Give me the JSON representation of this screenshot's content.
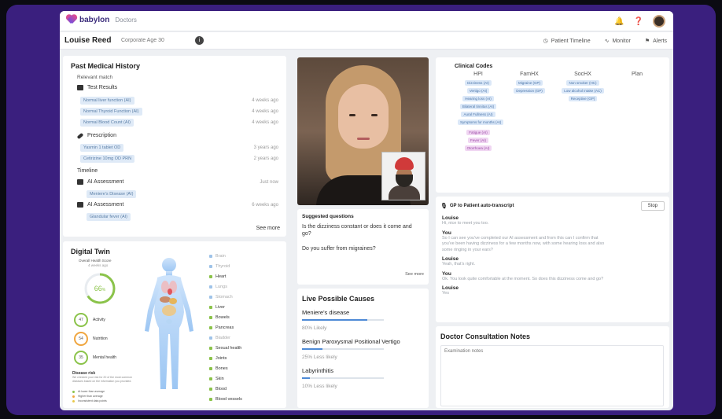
{
  "app": {
    "brand": "babylon",
    "section": "Doctors"
  },
  "patient": {
    "name": "Louise Reed",
    "meta": "Corporate   Age 30",
    "info_glyph": "i"
  },
  "nav": {
    "timeline": "Patient Timeline",
    "monitor": "Monitor",
    "alerts": "Alerts"
  },
  "history": {
    "title": "Past Medical History",
    "subtitle": "Relevant match",
    "test_results_label": "Test Results",
    "test_results": [
      {
        "name": "Normal liver function (AI)",
        "when": "4 weeks ago"
      },
      {
        "name": "Normal Thyroid Function (AI)",
        "when": "4 weeks ago"
      },
      {
        "name": "Normal Blood Count (AI)",
        "when": "4 weeks ago"
      }
    ],
    "prescription_label": "Prescription",
    "prescriptions": [
      {
        "name": "Yasmin 1 tablet OD",
        "when": "3 years ago"
      },
      {
        "name": "Cetirizine 10mg OD PRN",
        "when": "2 years ago"
      }
    ],
    "timeline_label": "Timeline",
    "ai1": {
      "label": "AI Assessment",
      "when": "Just now",
      "tag": "Meniere's Disease (AI)"
    },
    "ai2": {
      "label": "AI Assessment",
      "when": "6 weeks ago",
      "tag": "Glandular fever (AI)"
    },
    "see_more": "See more"
  },
  "twin": {
    "title": "Digital Twin",
    "score_label": "Overall Health Score",
    "score_sub": "4 weeks ago",
    "score": "66",
    "score_unit": "%",
    "score_fraction": 0.66,
    "gauges": [
      {
        "label": "Activity",
        "value": "47"
      },
      {
        "label": "Nutrition",
        "value": "54"
      },
      {
        "label": "Mental health",
        "value": "35"
      }
    ],
    "disease_risk_title": "Disease risk",
    "disease_risk_text": "We checked your risk for 20 of the most common diseases based on the information you provided.",
    "risk_keys": [
      "At lower than average",
      "Higher than average",
      "Inconsistent data points"
    ],
    "organs": [
      {
        "name": "Brain",
        "dim": true
      },
      {
        "name": "Thyroid",
        "dim": true
      },
      {
        "name": "Heart",
        "dim": false
      },
      {
        "name": "Lungs",
        "dim": true
      },
      {
        "name": "Stomach",
        "dim": true
      },
      {
        "name": "Liver",
        "dim": false
      },
      {
        "name": "Bowels",
        "dim": false
      },
      {
        "name": "Pancreas",
        "dim": false
      },
      {
        "name": "Bladder",
        "dim": true
      },
      {
        "name": "Sexual health",
        "dim": false
      },
      {
        "name": "Joints",
        "dim": false
      },
      {
        "name": "Bones",
        "dim": false
      },
      {
        "name": "Skin",
        "dim": false
      },
      {
        "name": "Blood",
        "dim": false
      },
      {
        "name": "Blood vessels",
        "dim": false
      }
    ]
  },
  "questions": {
    "title": "Suggested questions",
    "q1": "Is the dizziness constant or does it come and go?",
    "q2": "Do you suffer from migraines?",
    "see_more": "See more"
  },
  "causes": {
    "title": "Live Possible Causes",
    "items": [
      {
        "name": "Meniere's disease",
        "likelihood": "80% Likely",
        "fraction": 0.8
      },
      {
        "name": "Benign Paroxysmal Positional Vertigo",
        "likelihood": "25% Less likely",
        "fraction": 0.25
      },
      {
        "name": "Labyrinthitis",
        "likelihood": "10% Less likely",
        "fraction": 0.1
      }
    ]
  },
  "codes": {
    "title": "Clinical Codes",
    "columns": [
      "HPI",
      "FamHX",
      "SocHX",
      "Plan"
    ],
    "hpi": [
      "Dizziness (AI)",
      "Vertigo (AI)",
      "Hearing loss (AI)",
      "Bilateral tinnitus (AI)",
      "Aural Fullness (AI)",
      "Symptoms for months (AI)"
    ],
    "hpi_purple": [
      "Fatigue (AI)",
      "Fever (AI)",
      "Otorrhoea (AI)"
    ],
    "famhx": [
      "Migraine (GP)",
      "Depression (GP)"
    ],
    "sochx": [
      "Non smoker (HC)",
      "Low alcohol intake (AC)",
      "Receptive (GP)"
    ]
  },
  "transcript": {
    "title": "GP to Patient auto-transcript",
    "stop": "Stop",
    "lines": [
      {
        "who": "Louise",
        "text": "Hi, nice to meet you too."
      },
      {
        "who": "You",
        "text": "So I can see you've completed our AI assessment and from this can I confirm that you've been having dizziness for a few months now, with some hearing loss and also some ringing in your ears?"
      },
      {
        "who": "Louise",
        "text": "Yeah, that's right."
      },
      {
        "who": "You",
        "text": "Ok. You look quite comfortable at the moment. So does this dizziness come and go?"
      },
      {
        "who": "Louise",
        "text": "Yes"
      }
    ]
  },
  "notes": {
    "title": "Doctor Consultation Notes",
    "placeholder": "Examination notes"
  }
}
